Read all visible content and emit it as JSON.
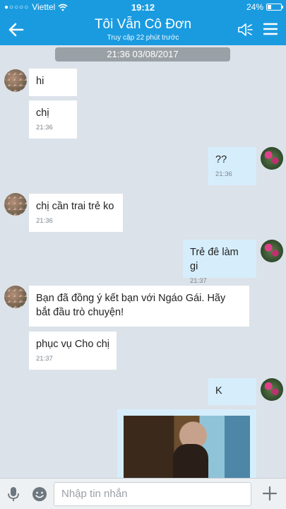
{
  "status_bar": {
    "carrier": "Viettel",
    "time": "19:12",
    "battery": "24%"
  },
  "header": {
    "title": "Tôi Vẫn Cô Đơn",
    "subtitle": "Truy cập 22 phút trước"
  },
  "date_separator": "21:36 03/08/2017",
  "messages": [
    {
      "side": "in",
      "text": "hi",
      "time": ""
    },
    {
      "side": "in",
      "text": "chị",
      "time": "21:36"
    },
    {
      "side": "out",
      "text": "??",
      "time": "21:36"
    },
    {
      "side": "in",
      "text": "chị cần trai trẻ ko",
      "time": "21:36"
    },
    {
      "side": "out",
      "text": "Trẻ đê làm gi",
      "time": "21:37"
    },
    {
      "side": "in",
      "text": "Bạn đã đồng ý kết bạn với Ngáo Gái. Hãy bắt đầu trò chuyện!",
      "time": ""
    },
    {
      "side": "in",
      "text": "phục vụ Cho chị",
      "time": "21:37"
    },
    {
      "side": "out",
      "text": "K",
      "time": ""
    }
  ],
  "composer": {
    "placeholder": "Nhập tin nhắn"
  },
  "colors": {
    "header": "#1a9be0",
    "background": "#dbe2e9",
    "incoming_bubble": "#ffffff",
    "outgoing_bubble": "#d6eefc"
  },
  "icons": [
    "signal-dots-icon",
    "wifi-icon",
    "battery-icon",
    "back-arrow-icon",
    "speaker-icon",
    "menu-icon",
    "mic-icon",
    "emoji-icon",
    "plus-icon"
  ]
}
